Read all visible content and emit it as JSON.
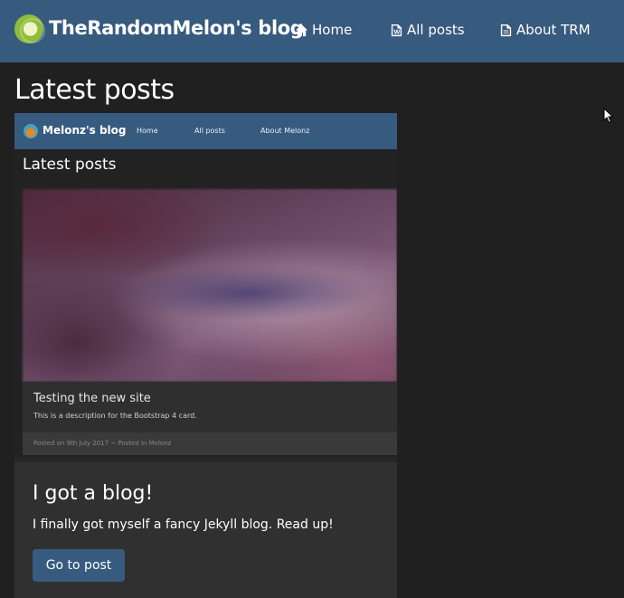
{
  "navbar": {
    "brand": "TheRandomMelon's blog",
    "items": [
      {
        "label": "Home",
        "icon": "home-icon"
      },
      {
        "label": "All posts",
        "icon": "word-document-icon"
      },
      {
        "label": "About TRM",
        "icon": "document-icon"
      }
    ],
    "color": "#375a7f"
  },
  "main": {
    "title": "Latest posts"
  },
  "post_card": {
    "thumbnail": {
      "brand": "Melonz's blog",
      "nav_items": [
        "Home",
        "All posts",
        "About Melonz"
      ],
      "title": "Latest posts",
      "card_title": "Testing the new site",
      "card_description": "This is a description for the Bootstrap 4 card.",
      "card_footer": "Posted on 9th July 2017 ~ Posted in Melonz"
    },
    "title": "I got a blog!",
    "text": "I finally got myself a fancy Jekyll blog. Read up!",
    "button_label": "Go to post"
  },
  "colors": {
    "background": "#202020",
    "card": "#303030",
    "accent": "#375a7f"
  }
}
